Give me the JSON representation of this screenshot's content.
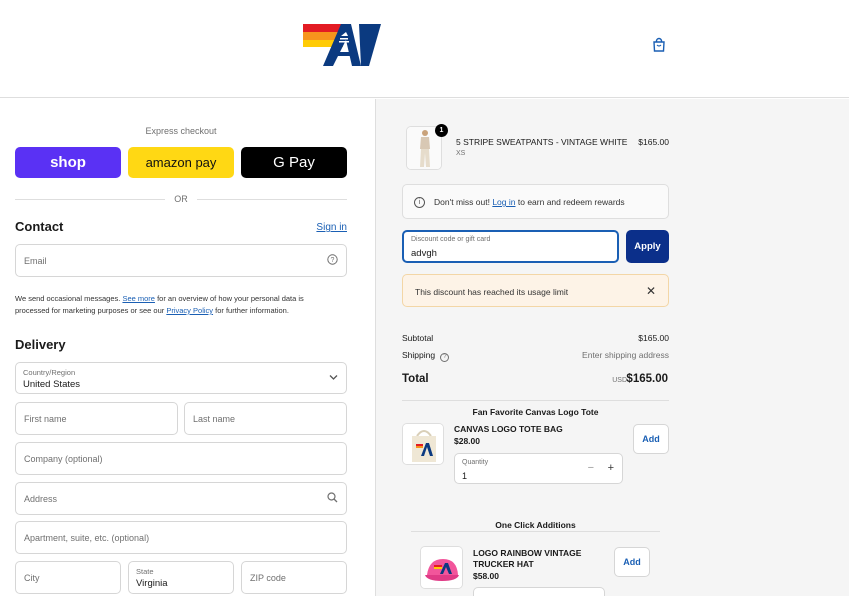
{
  "header": {
    "logo_alt": "AV",
    "colors": {
      "stripe_red": "#e31b23",
      "stripe_orange": "#f7941d",
      "stripe_yellow": "#ffcb05",
      "brand_blue": "#0b3a80"
    }
  },
  "express": {
    "label": "Express checkout",
    "shop_label": "shop",
    "amazon_label": "amazon pay",
    "gpay_label": "G Pay",
    "or_label": "OR"
  },
  "contact": {
    "title": "Contact",
    "signin": "Sign in",
    "email_placeholder": "Email",
    "note_pre": "We send occasional messages.",
    "note_link1": "See more",
    "note_mid": "for an overview of how your personal data is processed for marketing purposes or see our",
    "note_link2": "Privacy Policy",
    "note_post": "for further information."
  },
  "delivery": {
    "title": "Delivery",
    "country_label": "Country/Region",
    "country_value": "United States",
    "first_name": "First name",
    "last_name": "Last name",
    "company": "Company (optional)",
    "address": "Address",
    "apartment": "Apartment, suite, etc. (optional)",
    "city": "City",
    "state_label": "State",
    "state_value": "Virginia",
    "zip": "ZIP code"
  },
  "order": {
    "product_name": "5 STRIPE SWEATPANTS - VINTAGE WHITE",
    "product_variant": "XS",
    "product_price": "$165.00",
    "product_qty": "1",
    "rewards_pre": "Don't miss out!",
    "rewards_link": "Log in",
    "rewards_post": "to earn and redeem rewards",
    "discount_label": "Discount code or gift card",
    "discount_value": "advgh",
    "apply_label": "Apply",
    "error_text": "This discount has reached its usage limit",
    "subtotal_label": "Subtotal",
    "subtotal_value": "$165.00",
    "shipping_label": "Shipping",
    "shipping_value": "Enter shipping address",
    "total_label": "Total",
    "total_currency": "USD",
    "total_value": "$165.00"
  },
  "upsell1": {
    "title": "Fan Favorite Canvas Logo Tote",
    "name": "CANVAS LOGO TOTE BAG",
    "price": "$28.00",
    "qty_label": "Quantity",
    "qty_value": "1",
    "add_label": "Add"
  },
  "upsell2": {
    "title": "One Click Additions",
    "name_line1": "LOGO RAINBOW VINTAGE",
    "name_line2": "TRUCKER HAT",
    "price": "$58.00",
    "add_label": "Add"
  }
}
